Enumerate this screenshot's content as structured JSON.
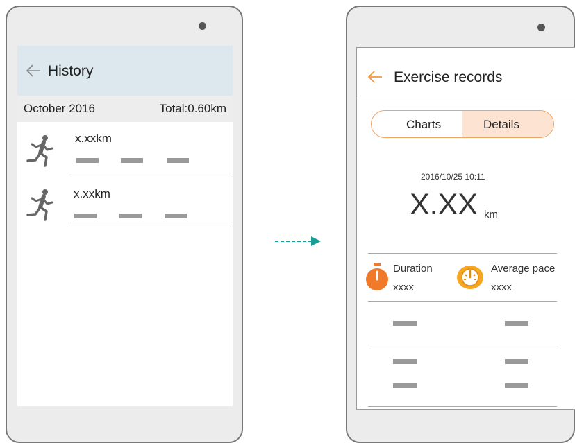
{
  "left_phone": {
    "title": "History",
    "month": "October 2016",
    "total": "Total:0.60km",
    "records": [
      {
        "distance": "x.xxkm",
        "icon": "runner-icon"
      },
      {
        "distance": "x.xxkm",
        "icon": "runner-icon"
      }
    ]
  },
  "arrow": {
    "icon": "dashed-arrow-icon",
    "color": "#1a9e96"
  },
  "right_phone": {
    "title": "Exercise records",
    "tabs": [
      {
        "label": "Charts",
        "active": false
      },
      {
        "label": "Details",
        "active": true
      }
    ],
    "datetime": "2016/10/25 10:11",
    "distance_value": "X.XX",
    "distance_unit": "km",
    "stats": [
      {
        "label": "Duration",
        "value": "xxxx",
        "icon": "stopwatch-icon"
      },
      {
        "label": "Average pace",
        "value": "xxxx",
        "icon": "speedometer-icon"
      }
    ]
  },
  "colors": {
    "accent": "#f39a3c",
    "header_bg": "#dde8ee",
    "tab_active_bg": "#fde3d2",
    "phone_body": "#ececec"
  }
}
